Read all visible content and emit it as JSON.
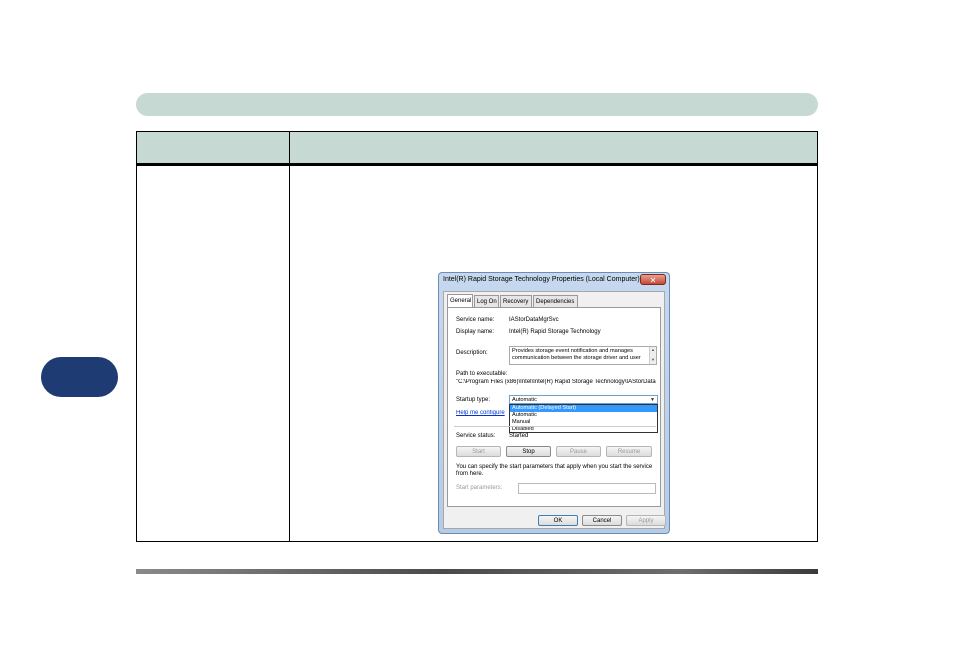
{
  "colors": {
    "header_band": "#c6d9d2",
    "side_tab": "#1f3b73",
    "selection": "#3399ff"
  },
  "dialog": {
    "title": "Intel(R) Rapid Storage Technology Properties (Local Computer)",
    "close_glyph": "✕",
    "tabs": [
      "General",
      "Log On",
      "Recovery",
      "Dependencies"
    ],
    "service_name_label": "Service name:",
    "service_name_value": "IAStorDataMgrSvc",
    "display_name_label": "Display name:",
    "display_name_value": "Intel(R) Rapid Storage Technology",
    "description_label": "Description:",
    "description_line1": "Provides storage event notification and manages",
    "description_line2": "communication between the storage driver and user",
    "path_label": "Path to executable:",
    "path_value": "\"C:\\Program Files (x86)\\Intel\\Intel(R) Rapid Storage Technology\\IAStorData",
    "startup_type_label": "Startup type:",
    "startup_type_value": "Automatic",
    "startup_options": [
      "Automatic (Delayed Start)",
      "Automatic",
      "Manual",
      "Disabled"
    ],
    "help_link": "Help me configure",
    "service_status_label": "Service status:",
    "service_status_value": "Started",
    "buttons": {
      "start": "Start",
      "stop": "Stop",
      "pause": "Pause",
      "resume": "Resume"
    },
    "start_params_note_line1": "You can specify the start parameters that apply when you start the service",
    "start_params_note_line2": "from here.",
    "start_params_label": "Start parameters:",
    "footer_buttons": {
      "ok": "OK",
      "cancel": "Cancel",
      "apply": "Apply"
    }
  }
}
